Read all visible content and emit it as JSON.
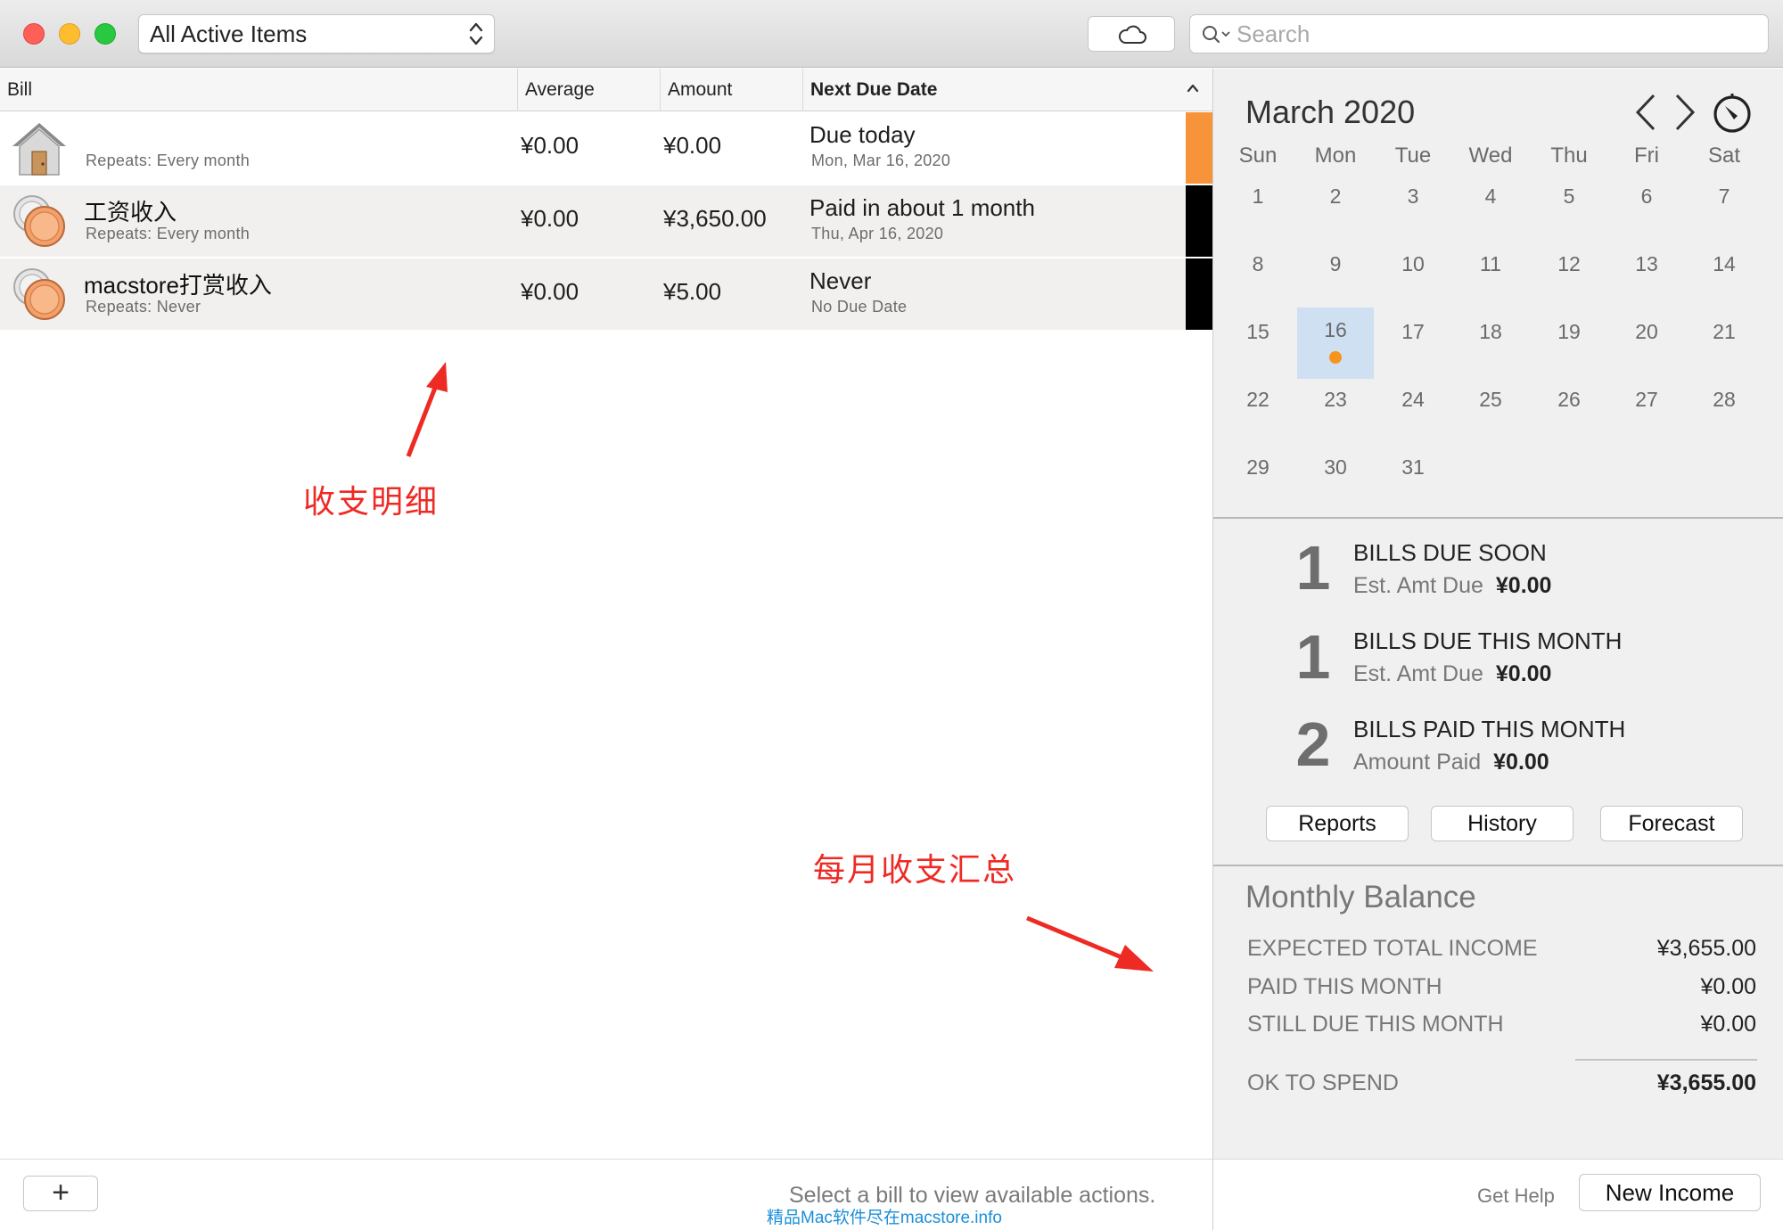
{
  "toolbar": {
    "filter_value": "All Active Items",
    "search_placeholder": "Search"
  },
  "list": {
    "columns": [
      "Bill",
      "Average",
      "Amount",
      "Next Due Date"
    ],
    "rows": [
      {
        "name": "",
        "repeats": "Repeats: Every month",
        "average": "¥0.00",
        "amount": "¥0.00",
        "due": "Due today",
        "due_date": "Mon, Mar 16, 2020",
        "icon": "house-icon",
        "status_color": "#f7943a"
      },
      {
        "name": "工资收入",
        "repeats": "Repeats: Every month",
        "average": "¥0.00",
        "amount": "¥3,650.00",
        "due": "Paid in about 1 month",
        "due_date": "Thu, Apr 16, 2020",
        "icon": "coins-icon",
        "status_color": "#000000"
      },
      {
        "name": "macstore打赏收入",
        "repeats": "Repeats: Never",
        "average": "¥0.00",
        "amount": "¥5.00",
        "due": "Never",
        "due_date": "No Due Date",
        "icon": "coins-icon",
        "status_color": "#000000"
      }
    ]
  },
  "annotations": {
    "detail": "收支明细",
    "summary": "每月收支汇总"
  },
  "footer": {
    "add_label": "+",
    "hint": "Select a bill to view available actions.",
    "watermark": "精品Mac软件尽在macstore.info",
    "get_help": "Get Help",
    "new_income": "New Income"
  },
  "calendar": {
    "title": "March 2020",
    "weekdays": [
      "Sun",
      "Mon",
      "Tue",
      "Wed",
      "Thu",
      "Fri",
      "Sat"
    ],
    "selected_day": "16",
    "weeks": [
      [
        "1",
        "2",
        "3",
        "4",
        "5",
        "6",
        "7"
      ],
      [
        "8",
        "9",
        "10",
        "11",
        "12",
        "13",
        "14"
      ],
      [
        "15",
        "16",
        "17",
        "18",
        "19",
        "20",
        "21"
      ],
      [
        "22",
        "23",
        "24",
        "25",
        "26",
        "27",
        "28"
      ],
      [
        "29",
        "30",
        "31",
        "",
        "",
        "",
        ""
      ]
    ]
  },
  "summary": [
    {
      "count": "1",
      "title": "BILLS DUE SOON",
      "label": "Est. Amt Due",
      "value": "¥0.00"
    },
    {
      "count": "1",
      "title": "BILLS DUE THIS MONTH",
      "label": "Est. Amt Due",
      "value": "¥0.00"
    },
    {
      "count": "2",
      "title": "BILLS PAID THIS MONTH",
      "label": "Amount Paid",
      "value": "¥0.00"
    }
  ],
  "panel_buttons": {
    "reports": "Reports",
    "history": "History",
    "forecast": "Forecast"
  },
  "monthly_balance": {
    "title": "Monthly Balance",
    "rows": [
      {
        "label": "EXPECTED TOTAL INCOME",
        "value": "¥3,655.00"
      },
      {
        "label": "PAID THIS MONTH",
        "value": "¥0.00"
      },
      {
        "label": "STILL DUE THIS MONTH",
        "value": "¥0.00"
      },
      {
        "label": "OK TO SPEND",
        "value": "¥3,655.00"
      }
    ]
  },
  "colors": {
    "accent_orange": "#f7943a",
    "annotation_red": "#ee2a24",
    "selected_day_bg": "#cfe0f2"
  }
}
